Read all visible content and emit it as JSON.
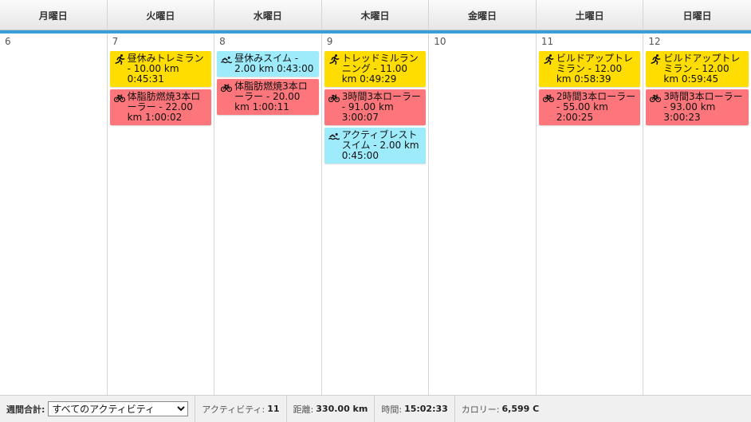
{
  "days": [
    {
      "header": "月曜日",
      "date": "6",
      "events": []
    },
    {
      "header": "火曜日",
      "date": "7",
      "events": [
        {
          "type": "run",
          "icon": "running-icon",
          "text": "昼休みトレミラン - 10.00 km 0:45:31"
        },
        {
          "type": "bike",
          "icon": "cycling-icon",
          "text": "体脂肪燃焼3本ローラー - 22.00 km 1:00:02"
        }
      ]
    },
    {
      "header": "水曜日",
      "date": "8",
      "events": [
        {
          "type": "swim",
          "icon": "swimming-icon",
          "text": "昼休みスイム - 2.00 km 0:43:00"
        },
        {
          "type": "bike",
          "icon": "cycling-icon",
          "text": "体脂肪燃焼3本ローラー - 20.00 km 1:00:11"
        }
      ]
    },
    {
      "header": "木曜日",
      "date": "9",
      "events": [
        {
          "type": "run",
          "icon": "running-icon",
          "text": "トレッドミルランニング - 11.00 km 0:49:29"
        },
        {
          "type": "bike",
          "icon": "cycling-icon",
          "text": "3時間3本ローラー - 91.00 km 3:00:07"
        },
        {
          "type": "swim",
          "icon": "swimming-icon",
          "text": "アクティブレストスイム - 2.00 km 0:45:00"
        }
      ]
    },
    {
      "header": "金曜日",
      "date": "10",
      "events": []
    },
    {
      "header": "土曜日",
      "date": "11",
      "events": [
        {
          "type": "run",
          "icon": "running-icon",
          "text": "ビルドアップトレミラン - 12.00 km 0:58:39"
        },
        {
          "type": "bike",
          "icon": "cycling-icon",
          "text": "2時間3本ローラー - 55.00 km 2:00:25"
        }
      ]
    },
    {
      "header": "日曜日",
      "date": "12",
      "events": [
        {
          "type": "run",
          "icon": "running-icon",
          "text": "ビルドアップトレミラン - 12.00 km 0:59:45"
        },
        {
          "type": "bike",
          "icon": "cycling-icon",
          "text": "3時間3本ローラー - 93.00 km 3:00:23"
        }
      ]
    }
  ],
  "colors": {
    "run": "#ffdd00",
    "bike": "#fc767b",
    "swim": "#9eebfb",
    "accent": "#3a9fd8"
  },
  "footer": {
    "weekly_total_label": "週間合計:",
    "activity_filter": {
      "selected": "すべてのアクティビティ",
      "options": [
        "すべてのアクティビティ"
      ]
    },
    "activities_label": "アクティビティ:",
    "activities_value": "11",
    "distance_label": "距離:",
    "distance_value": "330.00 km",
    "time_label": "時間:",
    "time_value": "15:02:33",
    "calories_label": "カロリー:",
    "calories_value": "6,599 C"
  }
}
